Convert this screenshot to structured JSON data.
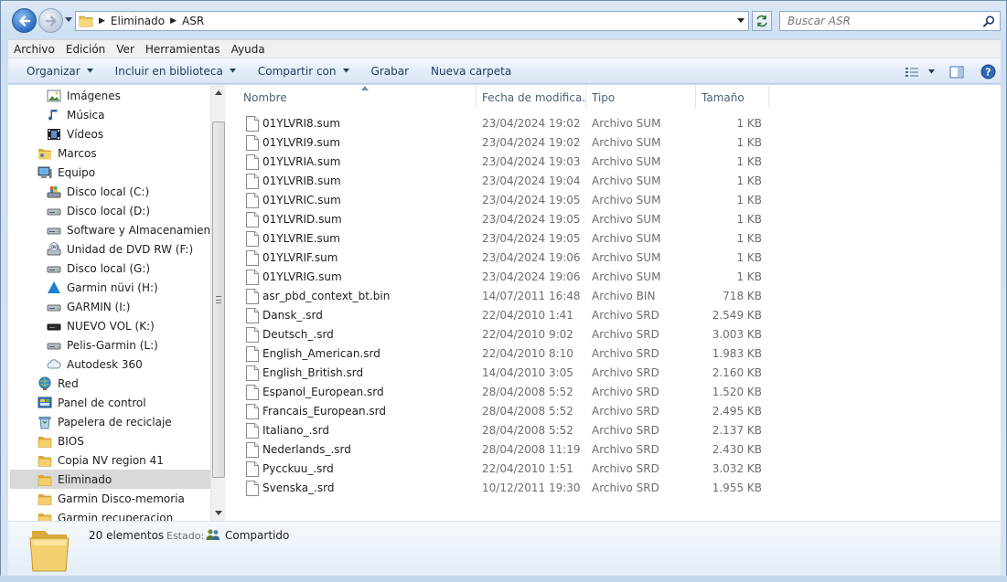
{
  "address": {
    "crumbs": [
      "Eliminado",
      "ASR"
    ],
    "search_placeholder": "Buscar ASR"
  },
  "menu": [
    "Archivo",
    "Edición",
    "Ver",
    "Herramientas",
    "Ayuda"
  ],
  "toolbar": {
    "organize": "Organizar",
    "include": "Incluir en biblioteca",
    "share": "Compartir con",
    "burn": "Grabar",
    "new_folder": "Nueva carpeta"
  },
  "nav": [
    {
      "label": "Imágenes",
      "icon": "pictures-icon",
      "indent": 1
    },
    {
      "label": "Música",
      "icon": "music-icon",
      "indent": 1
    },
    {
      "label": "Vídeos",
      "icon": "videos-icon",
      "indent": 1
    },
    {
      "label": "Marcos",
      "icon": "user-folder-icon",
      "indent": 0
    },
    {
      "label": "Equipo",
      "icon": "computer-icon",
      "indent": 0
    },
    {
      "label": "Disco local (C:)",
      "icon": "system-drive-icon",
      "indent": 1
    },
    {
      "label": "Disco local (D:)",
      "icon": "drive-icon",
      "indent": 1
    },
    {
      "label": "Software y Almacenamiento (",
      "icon": "drive-icon",
      "indent": 1
    },
    {
      "label": "Unidad de DVD RW (F:)",
      "icon": "dvd-drive-icon",
      "indent": 1
    },
    {
      "label": "Disco local (G:)",
      "icon": "drive-icon",
      "indent": 1
    },
    {
      "label": "Garmin nüvi (H:)",
      "icon": "garmin-icon",
      "indent": 1
    },
    {
      "label": "GARMIN (I:)",
      "icon": "drive-icon",
      "indent": 1
    },
    {
      "label": "NUEVO VOL (K:)",
      "icon": "drive-black-icon",
      "indent": 1
    },
    {
      "label": "Pelis-Garmin (L:)",
      "icon": "drive-icon",
      "indent": 1
    },
    {
      "label": "Autodesk 360",
      "icon": "cloud-icon",
      "indent": 1
    },
    {
      "label": "Red",
      "icon": "network-icon",
      "indent": 0
    },
    {
      "label": "Panel de control",
      "icon": "control-panel-icon",
      "indent": 0
    },
    {
      "label": "Papelera de reciclaje",
      "icon": "recycle-bin-icon",
      "indent": 0
    },
    {
      "label": "BIOS",
      "icon": "folder-icon",
      "indent": 0
    },
    {
      "label": "Copia NV region 41",
      "icon": "folder-icon",
      "indent": 0
    },
    {
      "label": "Eliminado",
      "icon": "folder-icon",
      "indent": 0,
      "selected": true
    },
    {
      "label": "Garmin Disco-memoria",
      "icon": "folder-icon",
      "indent": 0
    },
    {
      "label": "Garmin recuperacion",
      "icon": "folder-icon",
      "indent": 0
    }
  ],
  "columns": {
    "name": "Nombre",
    "date": "Fecha de modifica...",
    "type": "Tipo",
    "size": "Tamaño"
  },
  "files": [
    {
      "name": "01YLVRI8.sum",
      "date": "23/04/2024 19:02",
      "type": "Archivo SUM",
      "size": "1 KB"
    },
    {
      "name": "01YLVRI9.sum",
      "date": "23/04/2024 19:02",
      "type": "Archivo SUM",
      "size": "1 KB"
    },
    {
      "name": "01YLVRIA.sum",
      "date": "23/04/2024 19:03",
      "type": "Archivo SUM",
      "size": "1 KB"
    },
    {
      "name": "01YLVRIB.sum",
      "date": "23/04/2024 19:04",
      "type": "Archivo SUM",
      "size": "1 KB"
    },
    {
      "name": "01YLVRIC.sum",
      "date": "23/04/2024 19:05",
      "type": "Archivo SUM",
      "size": "1 KB"
    },
    {
      "name": "01YLVRID.sum",
      "date": "23/04/2024 19:05",
      "type": "Archivo SUM",
      "size": "1 KB"
    },
    {
      "name": "01YLVRIE.sum",
      "date": "23/04/2024 19:05",
      "type": "Archivo SUM",
      "size": "1 KB"
    },
    {
      "name": "01YLVRIF.sum",
      "date": "23/04/2024 19:06",
      "type": "Archivo SUM",
      "size": "1 KB"
    },
    {
      "name": "01YLVRIG.sum",
      "date": "23/04/2024 19:06",
      "type": "Archivo SUM",
      "size": "1 KB"
    },
    {
      "name": "asr_pbd_context_bt.bin",
      "date": "14/07/2011 16:48",
      "type": "Archivo BIN",
      "size": "718 KB"
    },
    {
      "name": "Dansk_.srd",
      "date": "22/04/2010 1:41",
      "type": "Archivo SRD",
      "size": "2.549 KB"
    },
    {
      "name": "Deutsch_.srd",
      "date": "22/04/2010 9:02",
      "type": "Archivo SRD",
      "size": "3.003 KB"
    },
    {
      "name": "English_American.srd",
      "date": "22/04/2010 8:10",
      "type": "Archivo SRD",
      "size": "1.983 KB"
    },
    {
      "name": "English_British.srd",
      "date": "14/04/2010 3:05",
      "type": "Archivo SRD",
      "size": "2.160 KB"
    },
    {
      "name": "Espanol_European.srd",
      "date": "28/04/2008 5:52",
      "type": "Archivo SRD",
      "size": "1.520 KB"
    },
    {
      "name": "Francais_European.srd",
      "date": "28/04/2008 5:52",
      "type": "Archivo SRD",
      "size": "2.495 KB"
    },
    {
      "name": "Italiano_.srd",
      "date": "28/04/2008 5:52",
      "type": "Archivo SRD",
      "size": "2.137 KB"
    },
    {
      "name": "Nederlands_.srd",
      "date": "28/04/2008 11:19",
      "type": "Archivo SRD",
      "size": "2.430 KB"
    },
    {
      "name": "Pycckuu_.srd",
      "date": "22/04/2010 1:51",
      "type": "Archivo SRD",
      "size": "3.032 KB"
    },
    {
      "name": "Svenska_.srd",
      "date": "10/12/2011 19:30",
      "type": "Archivo SRD",
      "size": "1.955 KB"
    }
  ],
  "details": {
    "count": "20 elementos",
    "estado_label": "Estado:",
    "estado_value": "Compartido"
  },
  "colors": {
    "accent": "#1e3a5f",
    "selected_bg": "#d9d9d9",
    "header_text": "#4c607a",
    "muted_text": "#6d6d6d"
  }
}
